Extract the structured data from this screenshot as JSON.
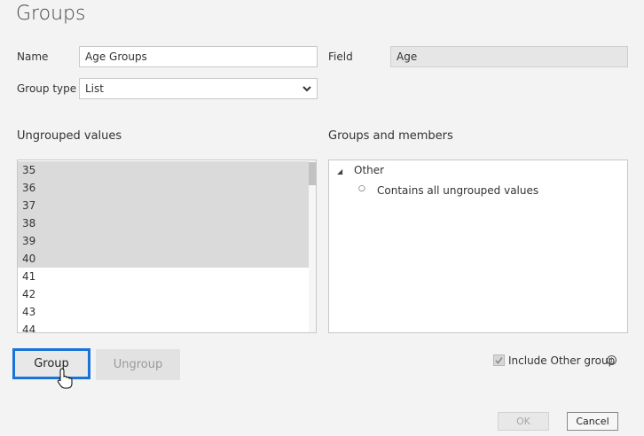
{
  "dialog": {
    "title": "Groups"
  },
  "form": {
    "name_label": "Name",
    "name_value": "Age Groups",
    "field_label": "Field",
    "field_value": "Age",
    "group_type_label": "Group type",
    "group_type_value": "List"
  },
  "ungrouped": {
    "title": "Ungrouped values",
    "items": [
      {
        "label": "35",
        "selected": true
      },
      {
        "label": "36",
        "selected": true
      },
      {
        "label": "37",
        "selected": true
      },
      {
        "label": "38",
        "selected": true
      },
      {
        "label": "39",
        "selected": true
      },
      {
        "label": "40",
        "selected": true
      },
      {
        "label": "41",
        "selected": false
      },
      {
        "label": "42",
        "selected": false
      },
      {
        "label": "43",
        "selected": false
      },
      {
        "label": "44",
        "selected": false
      }
    ]
  },
  "groups": {
    "title": "Groups and members",
    "group_name": "Other",
    "member": "Contains all ungrouped values"
  },
  "buttons": {
    "group": "Group",
    "ungroup": "Ungroup",
    "ok": "OK",
    "cancel": "Cancel"
  },
  "include_other": {
    "label": "Include Other group",
    "checked": true
  },
  "colors": {
    "highlight": "#1a73d9",
    "selection": "#dadada"
  },
  "icons": {
    "dropdown": "chevron-down-icon",
    "info": "info-icon",
    "expand": "triangle-expanded-icon",
    "bullet": "circle-bullet-icon",
    "cursor": "hand-pointer-icon"
  }
}
